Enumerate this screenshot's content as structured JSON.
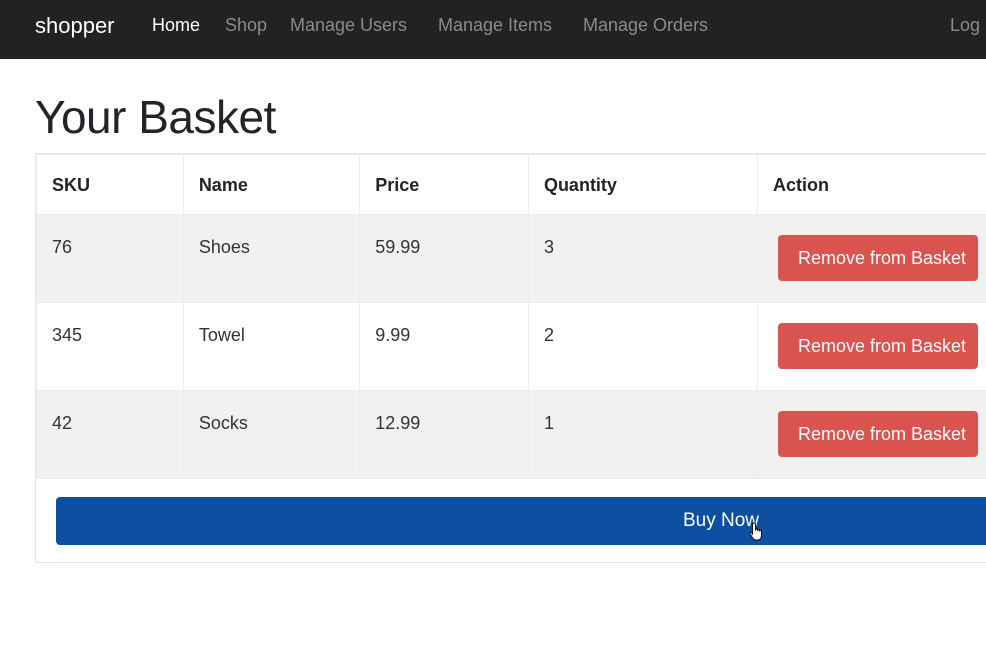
{
  "navbar": {
    "brand": "shopper",
    "links": [
      {
        "label": "Home",
        "active": true
      },
      {
        "label": "Shop",
        "active": false
      },
      {
        "label": "Manage Users",
        "active": false
      },
      {
        "label": "Manage Items",
        "active": false
      },
      {
        "label": "Manage Orders",
        "active": false
      }
    ],
    "right_link": "Logout",
    "right_link_visible": "Log"
  },
  "page": {
    "title": "Your Basket"
  },
  "basket": {
    "columns": [
      "SKU",
      "Name",
      "Price",
      "Quantity",
      "Action"
    ],
    "rows": [
      {
        "sku": "76",
        "name": "Shoes",
        "price": "59.99",
        "quantity": "3",
        "action": "Remove from Basket"
      },
      {
        "sku": "345",
        "name": "Towel",
        "price": "9.99",
        "quantity": "2",
        "action": "Remove from Basket"
      },
      {
        "sku": "42",
        "name": "Socks",
        "price": "12.99",
        "quantity": "1",
        "action": "Remove from Basket"
      }
    ],
    "buy_label": "Buy Now"
  },
  "colors": {
    "navbar_bg": "#222222",
    "remove_button": "#d9534f",
    "buy_button": "#0d4fa3"
  }
}
